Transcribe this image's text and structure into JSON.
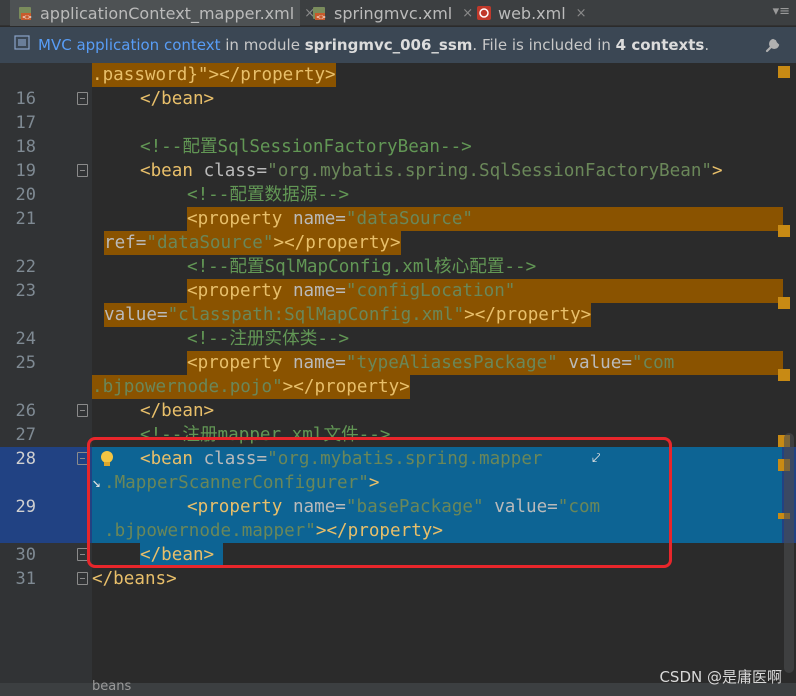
{
  "tabs": [
    {
      "label": "applicationContext_mapper.xml",
      "icon": "xml-file-icon",
      "active": true
    },
    {
      "label": "springmvc.xml",
      "icon": "xml-file-icon",
      "active": false
    },
    {
      "label": "web.xml",
      "icon": "web-xml-file-icon",
      "active": false
    }
  ],
  "tab_close_glyph": "×",
  "tab_overflow": "▾≡",
  "infobar": {
    "link": "MVC application context",
    "text1": " in module ",
    "module": "springmvc_006_ssm",
    "text2": ". File is included in ",
    "count": "4 contexts",
    "text3": "."
  },
  "lines": {
    "l15b": ".password}\"></property>",
    "n16": "16",
    "l16": "</bean>",
    "n17": "17",
    "n18": "18",
    "l18": "<!--配置SqlSessionFactoryBean-->",
    "n19": "19",
    "l19_tag": "<bean ",
    "l19_attr": "class=",
    "l19_val": "\"org.mybatis.spring.SqlSessionFactoryBean\"",
    "l19_end": ">",
    "n20": "20",
    "l20": "<!--配置数据源-->",
    "n21": "21",
    "l21_tag": "<property ",
    "l21_attr": "name=",
    "l21_val": "\"dataSource\"",
    "l21b_attr": "ref=",
    "l21b_val": "\"dataSource\"",
    "l21b_end": "></property>",
    "n22": "22",
    "l22": "<!--配置SqlMapConfig.xml核心配置-->",
    "n23": "23",
    "l23_tag": "<property ",
    "l23_attr": "name=",
    "l23_val": "\"configLocation\"",
    "l23b_attr": "value=",
    "l23b_val": "\"classpath:SqlMapConfig.xml\"",
    "l23b_end": "></property>",
    "n24": "24",
    "l24": "<!--注册实体类-->",
    "n25": "25",
    "l25_tag": "<property ",
    "l25_attr": "name=",
    "l25_val": "\"typeAliasesPackage\"",
    "l25_attr2": " value=",
    "l25_val2": "\"com",
    "l25b_val": ".bjpowernode.pojo\"",
    "l25b_end": "></property>",
    "n26": "26",
    "l26": "</bean>",
    "n27": "27",
    "l27": "<!--注册mapper.xml文件-->",
    "n28": "28",
    "l28_tag": "<bean ",
    "l28_attr": "class=",
    "l28_val": "\"org.mybatis.spring.mapper",
    "l28b_val": ".MapperScannerConfigurer\"",
    "l28b_end": ">",
    "n29": "29",
    "l29_tag": "<property ",
    "l29_attr": "name=",
    "l29_val": "\"basePackage\"",
    "l29_attr2": " value=",
    "l29_val2": "\"com",
    "l29b_val": ".bjpowernode.mapper\"",
    "l29b_end": "></property>",
    "n30": "30",
    "l30": "</bean>",
    "n31": "31",
    "l31": "</beans>"
  },
  "wrap_glyph_end": "⤦",
  "wrap_glyph_start": "↘",
  "breadcrumb": "beans",
  "watermark": "CSDN @是庸医啊",
  "colors": {
    "tag": "#e8bf6a",
    "attribute": "#bababa",
    "string": "#6a8759",
    "comment": "#629755",
    "selection": "#0d6494",
    "highlight": "#8a5300",
    "annotation_box": "#e8262b"
  }
}
